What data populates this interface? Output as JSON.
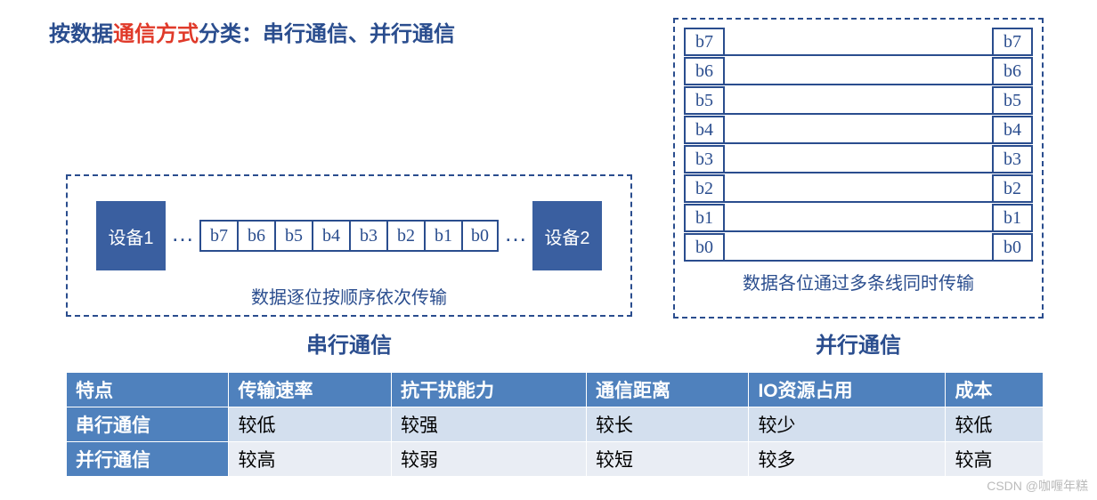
{
  "title": {
    "pre": "按数据",
    "red": "通信方式",
    "post": "分类：串行通信、并行通信"
  },
  "serial": {
    "dev1": "设备1",
    "dev2": "设备2",
    "dots": "…",
    "bits": [
      "b7",
      "b6",
      "b5",
      "b4",
      "b3",
      "b2",
      "b1",
      "b0"
    ],
    "caption": "数据逐位按顺序依次传输",
    "name": "串行通信"
  },
  "parallel": {
    "bits": [
      "b7",
      "b6",
      "b5",
      "b4",
      "b3",
      "b2",
      "b1",
      "b0"
    ],
    "caption": "数据各位通过多条线同时传输",
    "name": "并行通信"
  },
  "table": {
    "headers": [
      "特点",
      "传输速率",
      "抗干扰能力",
      "通信距离",
      "IO资源占用",
      "成本"
    ],
    "rows": [
      {
        "name": "串行通信",
        "cells": [
          "较低",
          "较强",
          "较长",
          "较少",
          "较低"
        ]
      },
      {
        "name": "并行通信",
        "cells": [
          "较高",
          "较弱",
          "较短",
          "较多",
          "较高"
        ]
      }
    ]
  },
  "watermark": "CSDN @咖喱年糕"
}
